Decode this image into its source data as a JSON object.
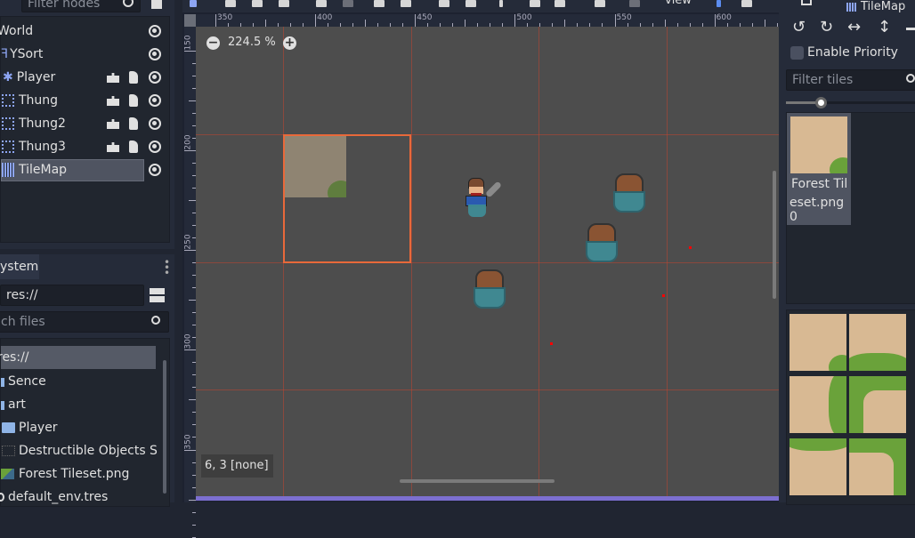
{
  "scene_tree": {
    "filter_placeholder": "Filter nodes",
    "nodes": [
      {
        "label": "World",
        "icon": "node2d-icon"
      },
      {
        "label": "YSort",
        "icon": "ysort-icon"
      },
      {
        "label": "Player",
        "icon": "kinematic-body-icon",
        "has_instance": true,
        "has_script": true
      },
      {
        "label": "Thung",
        "icon": "static-body-icon",
        "has_instance": true,
        "has_script": true
      },
      {
        "label": "Thung2",
        "icon": "static-body-icon",
        "has_instance": true,
        "has_script": true
      },
      {
        "label": "Thung3",
        "icon": "static-body-icon",
        "has_instance": true,
        "has_script": true
      },
      {
        "label": "TileMap",
        "icon": "tilemap-icon",
        "selected": true
      }
    ]
  },
  "filesystem": {
    "tab_label": "ystem",
    "path": "res://",
    "search_placeholder": "ch files",
    "items": [
      {
        "label": "res://",
        "selected": true
      },
      {
        "label": "Sence",
        "icon": "folder-icon"
      },
      {
        "label": "art",
        "icon": "folder-icon"
      },
      {
        "label": "Player",
        "icon": "folder-icon"
      },
      {
        "label": "Destructible Objects S",
        "icon": "image-icon"
      },
      {
        "label": "Forest Tileset.png",
        "icon": "image-icon"
      },
      {
        "label": "default_env.tres",
        "icon": "environment-icon"
      }
    ]
  },
  "toolbar": {
    "view_label": "view"
  },
  "viewport": {
    "zoom_label": "224.5 %",
    "ruler_x": [
      "350",
      "400",
      "450",
      "500",
      "550",
      "600"
    ],
    "ruler_y": [
      "150",
      "200",
      "250",
      "300",
      "350"
    ],
    "status": "6, 3 [none]",
    "accent": "#e8693a"
  },
  "tilemap_panel": {
    "title": "TileMap",
    "enable_priority_label": "Enable Priority",
    "enable_priority": false,
    "filter_placeholder": "Filter tiles",
    "tile_item_label": "Forest Tileset.png 0",
    "tile_item_line1": "Forest Til",
    "tile_item_line2": "eset.png 0"
  }
}
